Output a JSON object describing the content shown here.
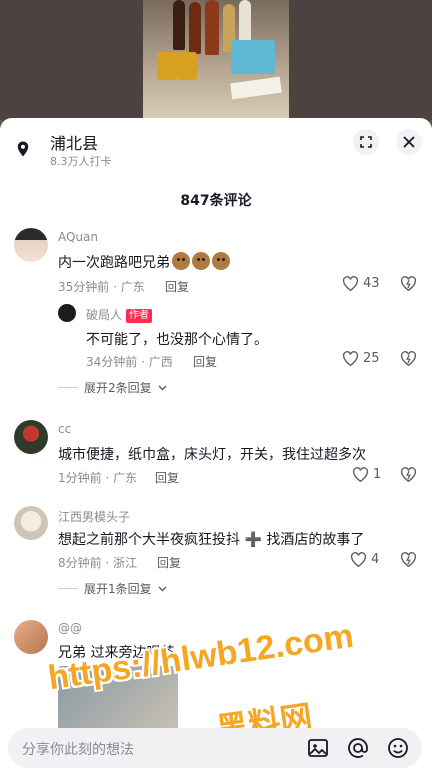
{
  "location": {
    "title": "浦北县",
    "subtitle": "8.3万人打卡"
  },
  "comments_count": "847条评论",
  "comments": [
    {
      "username": "AQuan",
      "text": "内一次跑路吧兄弟",
      "time_place": "35分钟前 · 广东",
      "reply_label": "回复",
      "likes": "43"
    },
    {
      "username": "破局人",
      "author_tag": "作者",
      "text": "不可能了，也没那个心情了。",
      "time_place": "34分钟前 · 广西",
      "reply_label": "回复",
      "likes": "25"
    },
    {
      "username": "cc",
      "text": "城市便捷，纸巾盒，床头灯，开关，我住过超多次",
      "time_place": "1分钟前 · 广东",
      "reply_label": "回复",
      "likes": "1"
    },
    {
      "username": "江西男模头子",
      "text": "想起之前那个大半夜疯狂投抖 ➕ 找酒店的故事了",
      "time_place": "8分钟前 · 浙江",
      "reply_label": "回复",
      "likes": "4"
    },
    {
      "username": "@@",
      "text": "兄弟 过来旁边喝茶"
    }
  ],
  "expand_replies": [
    "展开2条回复",
    "展开1条回复"
  ],
  "watermark": {
    "url": "https://hlwb12.com",
    "name": "黑料网"
  },
  "input": {
    "placeholder": "分享你此刻的想法"
  },
  "colors": {
    "accent": "#fe2c55",
    "watermark": "#f5a623"
  }
}
